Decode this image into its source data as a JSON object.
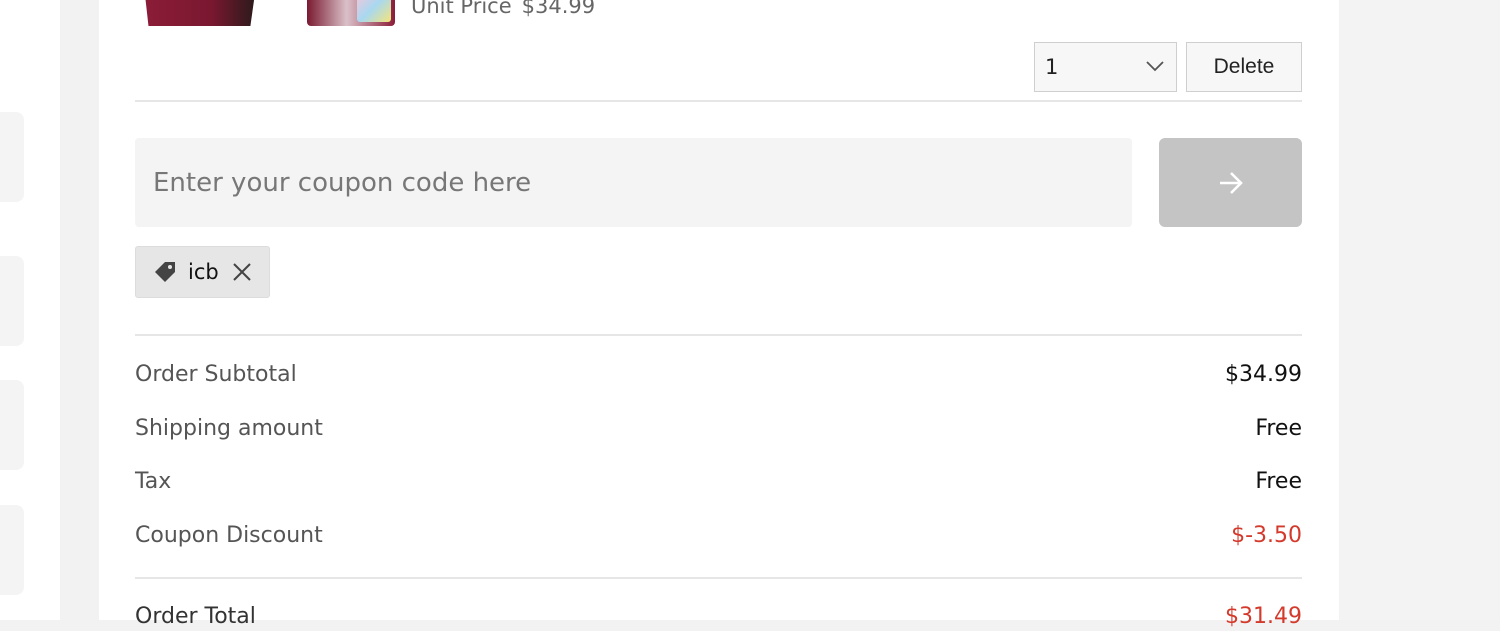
{
  "product": {
    "unit_price_label": "Unit Price",
    "unit_price_value": "$34.99"
  },
  "cart_item": {
    "quantity": "1",
    "delete_label": "Delete"
  },
  "coupon": {
    "placeholder": "Enter your coupon code here",
    "applied_code": "icb",
    "apply_icon": "arrow-right-icon"
  },
  "summary": {
    "subtotal_label": "Order Subtotal",
    "subtotal_value": "$34.99",
    "shipping_label": "Shipping amount",
    "shipping_value": "Free",
    "tax_label": "Tax",
    "tax_value": "Free",
    "discount_label": "Coupon Discount",
    "discount_value": "$-3.50",
    "total_label": "Order Total",
    "total_value": "$31.49"
  },
  "colors": {
    "accent_red": "#d33a2c",
    "apply_button_disabled": "#c4c4c4"
  }
}
